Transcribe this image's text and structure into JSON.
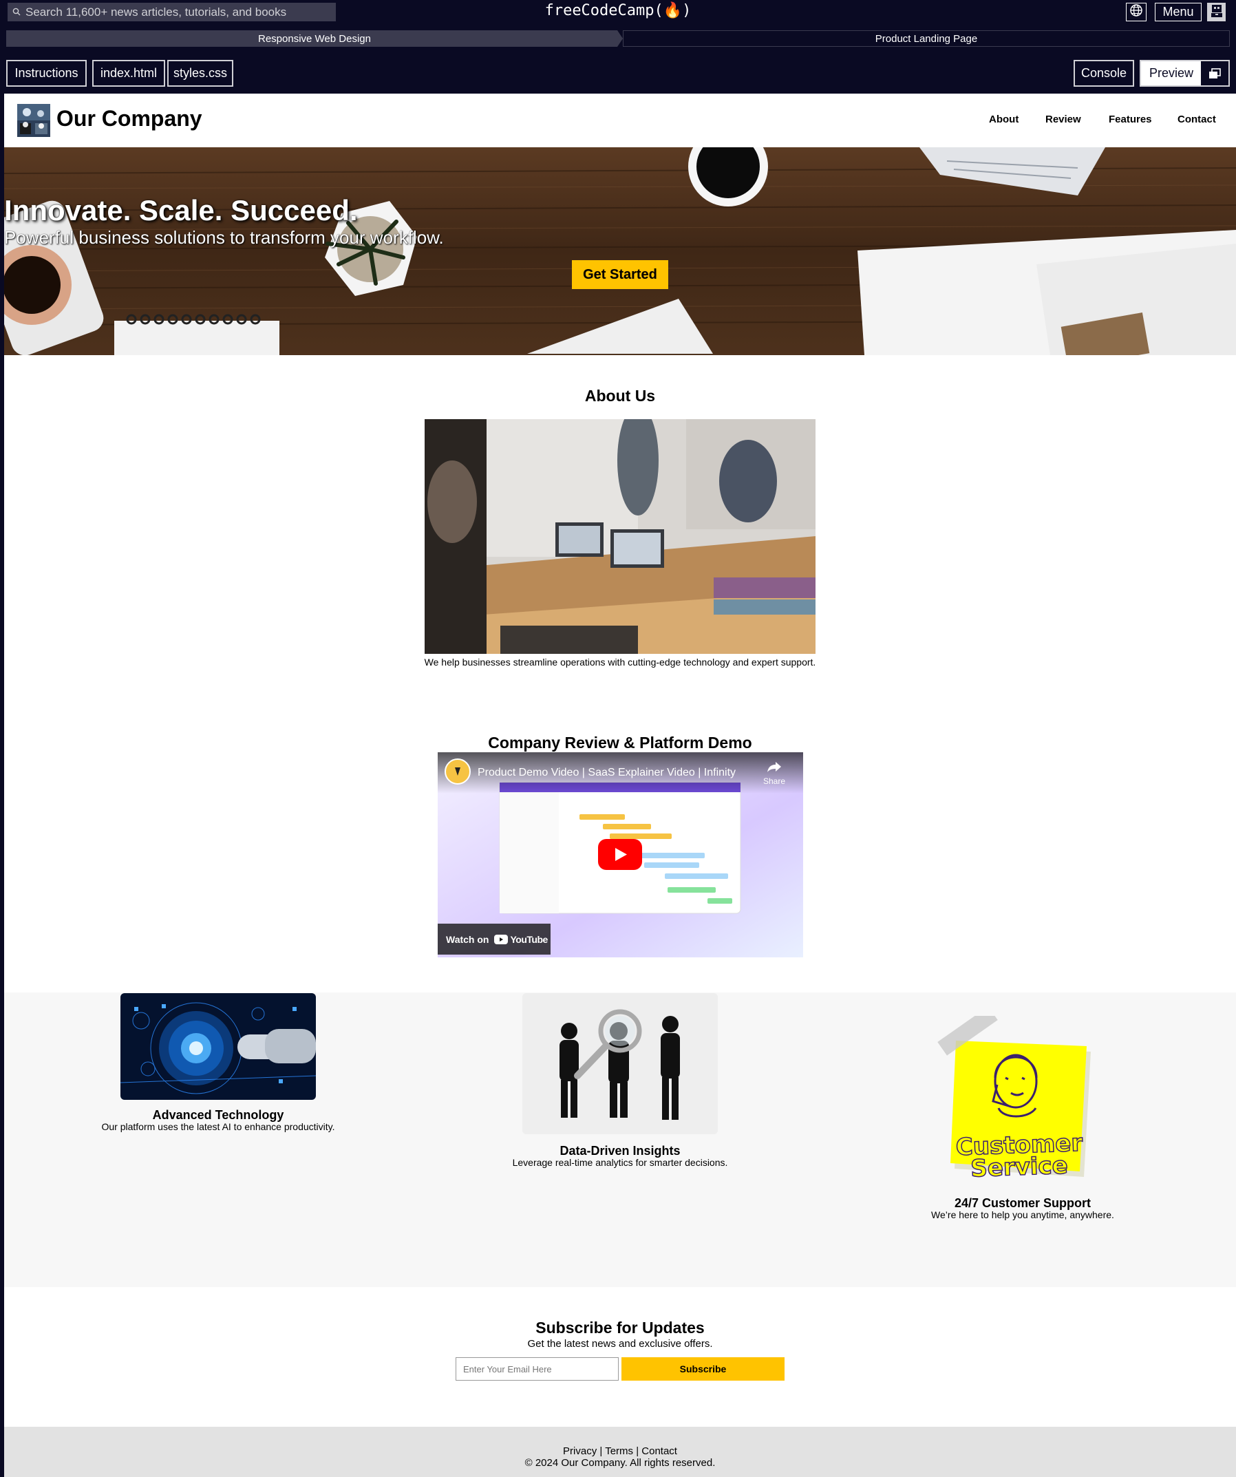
{
  "fcc": {
    "search_placeholder": "Search 11,600+ news articles, tutorials, and books",
    "logo": "freeCodeCamp(🔥)",
    "menu_label": "Menu",
    "breadcrumb": [
      "Responsive Web Design",
      "Product Landing Page"
    ],
    "tabs": {
      "instructions": "Instructions",
      "html": "index.html",
      "css": "styles.css",
      "console": "Console",
      "preview": "Preview"
    }
  },
  "site": {
    "company_name": "Our Company",
    "nav": [
      "About",
      "Review",
      "Features",
      "Contact"
    ],
    "hero": {
      "title": "Innovate. Scale. Succeed.",
      "subtitle": "Powerful business solutions to transform your workflow.",
      "cta": "Get Started"
    },
    "about": {
      "title": "About Us",
      "text": "We help businesses streamline operations with cutting-edge technology and expert support."
    },
    "review": {
      "title": "Company Review & Platform Demo",
      "video_title": "Product Demo Video | SaaS Explainer Video | Infinity",
      "share": "Share",
      "watch_on": "Watch on",
      "youtube": "YouTube"
    },
    "features": [
      {
        "title": "Advanced Technology",
        "desc": "Our platform uses the latest AI to enhance productivity."
      },
      {
        "title": "Data-Driven Insights",
        "desc": "Leverage real-time analytics for smarter decisions."
      },
      {
        "title": "24/7 Customer Support",
        "desc": "We’re here to help you anytime, anywhere.",
        "image_text": [
          "Customer",
          "Service"
        ]
      }
    ],
    "subscribe": {
      "title": "Subscribe for Updates",
      "desc": "Get the latest news and exclusive offers.",
      "placeholder": "Enter Your Email Here",
      "button": "Subscribe"
    },
    "footer": {
      "links": [
        "Privacy",
        "Terms",
        "Contact"
      ],
      "separator": " | ",
      "copyright": "© 2024 Our Company. All rights reserved."
    }
  },
  "colors": {
    "fcc_dark": "#0a0a23",
    "fcc_gray": "#3b3b4f",
    "accent_yellow": "#ffc300",
    "feature_bg": "#f7f7f7",
    "footer_bg": "#e2e2e2"
  }
}
